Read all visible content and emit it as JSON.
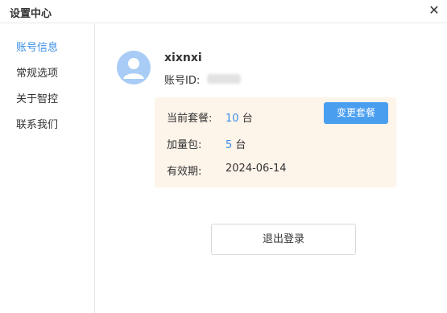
{
  "window": {
    "title": "设置中心",
    "close_glyph": "✕"
  },
  "sidebar": {
    "items": [
      {
        "label": "账号信息",
        "active": true
      },
      {
        "label": "常规选项",
        "active": false
      },
      {
        "label": "关于智控",
        "active": false
      },
      {
        "label": "联系我们",
        "active": false
      }
    ]
  },
  "account": {
    "avatar_icon": "user-avatar-icon",
    "username": "xixnxi",
    "id_label": "账号ID:"
  },
  "plan": {
    "current_label": "当前套餐:",
    "current_num": "10",
    "current_unit": "台",
    "addon_label": "加量包:",
    "addon_num": "5",
    "addon_unit": "台",
    "validity_label": "有效期:",
    "validity_value": "2024-06-14",
    "change_button": "变更套餐"
  },
  "actions": {
    "logout_button": "退出登录"
  },
  "colors": {
    "accent": "#3a8ee6",
    "button_blue": "#4a9ef0",
    "plan_bg": "#fdf4ea",
    "avatar": "#a8ccf5"
  }
}
